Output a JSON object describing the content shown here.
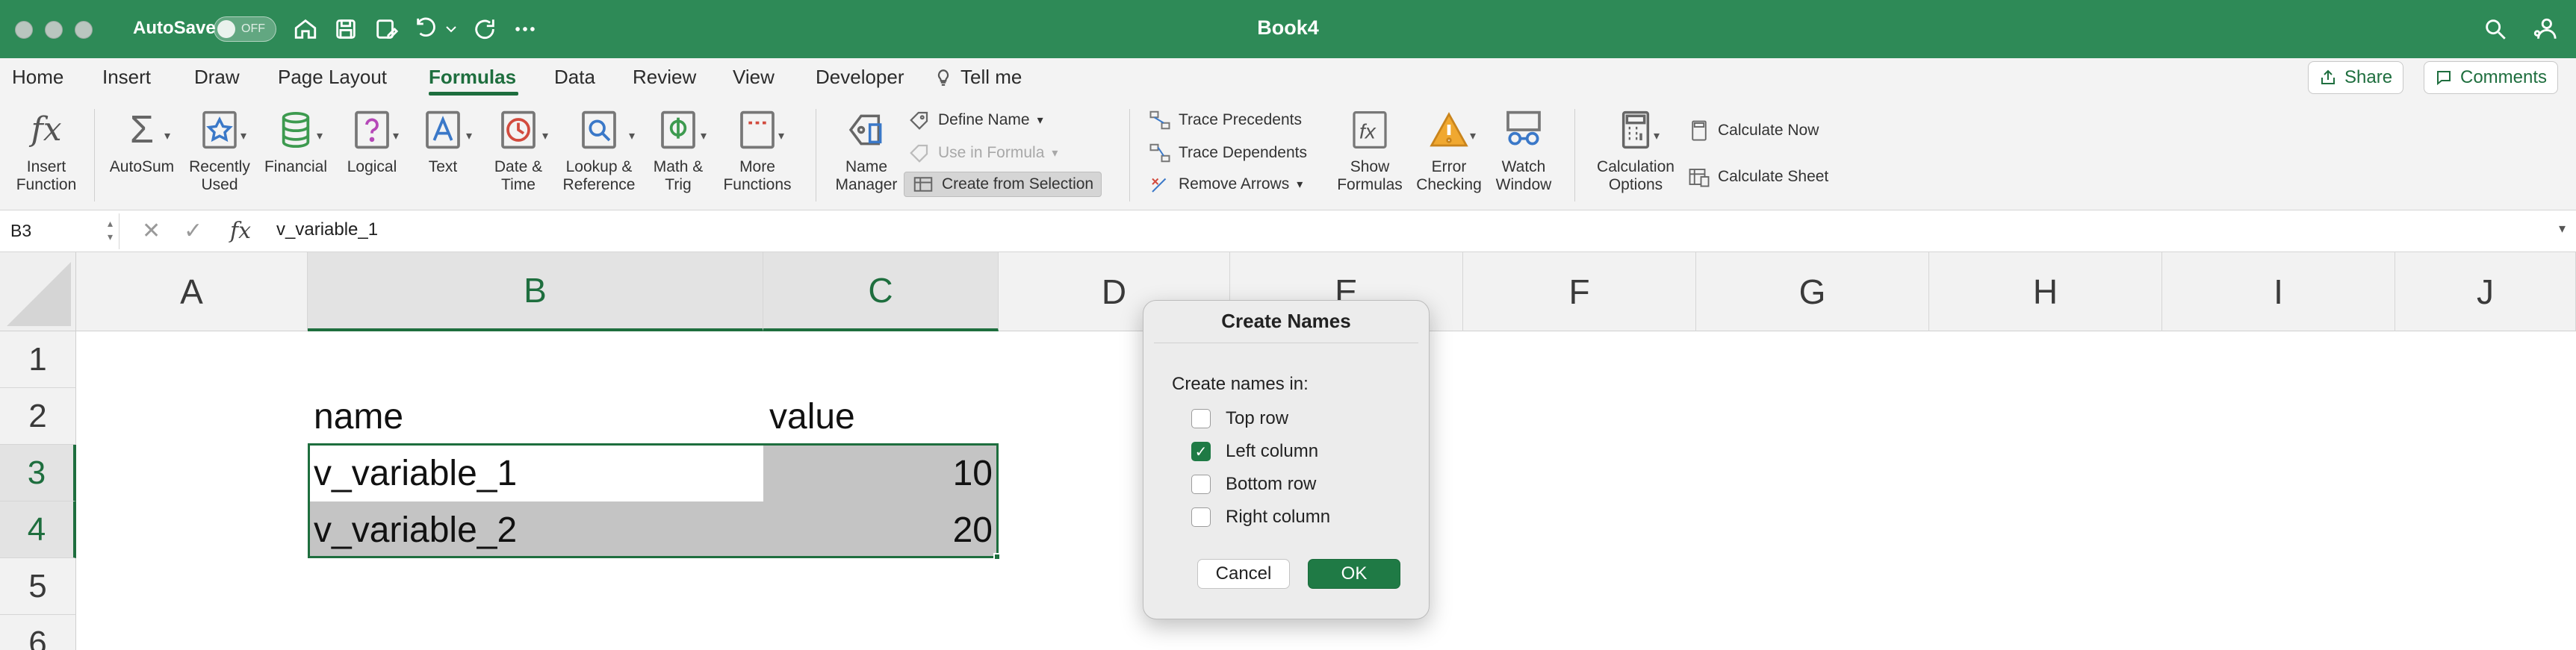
{
  "titlebar": {
    "autosave_label": "AutoSave",
    "autosave_state": "OFF",
    "doc_title": "Book4",
    "accent_color": "#2e8a57"
  },
  "menu": {
    "tabs": [
      "Home",
      "Insert",
      "Draw",
      "Page Layout",
      "Formulas",
      "Data",
      "Review",
      "View",
      "Developer"
    ],
    "active_tab": "Formulas",
    "tell_me": "Tell me",
    "share_label": "Share",
    "comments_label": "Comments"
  },
  "ribbon": {
    "insert_function": [
      "Insert",
      "Function"
    ],
    "autosum": "AutoSum",
    "recently_used": [
      "Recently",
      "Used"
    ],
    "financial": "Financial",
    "logical": "Logical",
    "text": "Text",
    "date_time": [
      "Date &",
      "Time"
    ],
    "lookup_reference": [
      "Lookup &",
      "Reference"
    ],
    "math_trig": [
      "Math &",
      "Trig"
    ],
    "more_functions": [
      "More",
      "Functions"
    ],
    "name_manager": [
      "Name",
      "Manager"
    ],
    "define_name": "Define Name",
    "use_in_formula": "Use in Formula",
    "create_from_selection": "Create from Selection",
    "trace_precedents": "Trace Precedents",
    "trace_dependents": "Trace Dependents",
    "remove_arrows": "Remove Arrows",
    "show_formulas": [
      "Show",
      "Formulas"
    ],
    "error_checking": [
      "Error",
      "Checking"
    ],
    "watch_window": [
      "Watch",
      "Window"
    ],
    "calculation_options": [
      "Calculation",
      "Options"
    ],
    "calculate_now": "Calculate Now",
    "calculate_sheet": "Calculate Sheet"
  },
  "formula_bar": {
    "name_box": "B3",
    "formula": "v_variable_1"
  },
  "grid": {
    "columns": [
      "A",
      "B",
      "C",
      "D",
      "E",
      "F",
      "G",
      "H",
      "I",
      "J"
    ],
    "selected_columns": [
      "B",
      "C"
    ],
    "rows": [
      "1",
      "2",
      "3",
      "4",
      "5",
      "6"
    ],
    "selected_rows": [
      "3",
      "4"
    ],
    "cells": {
      "B2": "name",
      "C2": "value",
      "B3": "v_variable_1",
      "C3": "10",
      "B4": "v_variable_2",
      "C4": "20"
    }
  },
  "dialog": {
    "title": "Create Names",
    "prompt": "Create names in:",
    "options": [
      {
        "label": "Top row",
        "checked": false
      },
      {
        "label": "Left column",
        "checked": true
      },
      {
        "label": "Bottom row",
        "checked": false
      },
      {
        "label": "Right column",
        "checked": false
      }
    ],
    "cancel_label": "Cancel",
    "ok_label": "OK"
  }
}
